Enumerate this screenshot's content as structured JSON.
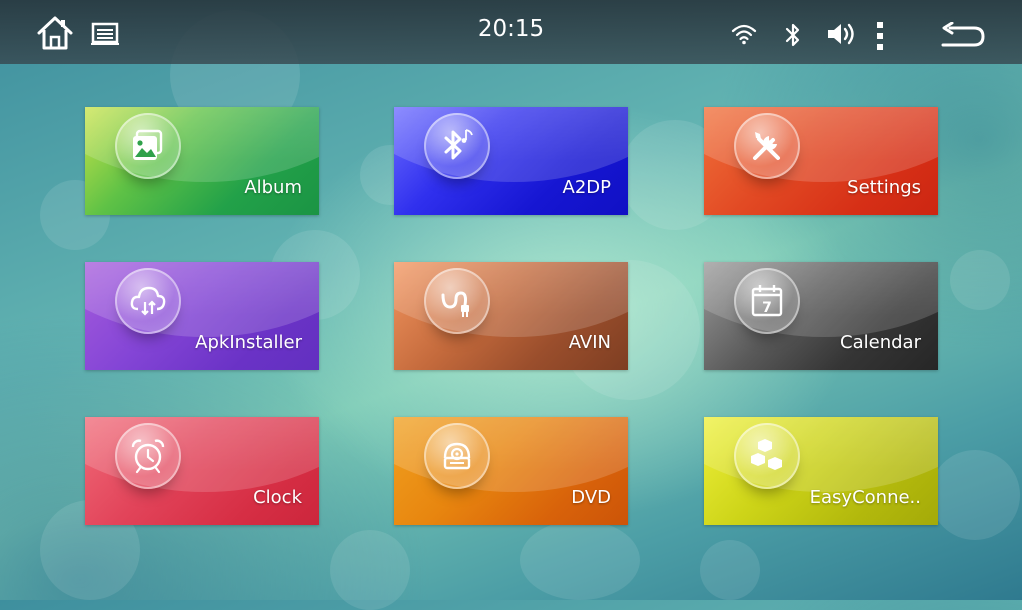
{
  "status_bar": {
    "time": "20:15",
    "icons": [
      "home-icon",
      "screen-icon",
      "wifi-icon",
      "bluetooth-icon",
      "volume-icon",
      "more-vert-icon",
      "back-icon"
    ]
  },
  "apps": [
    {
      "label": "Album",
      "icon": "album-icon",
      "color": "#2fb04a"
    },
    {
      "label": "A2DP",
      "icon": "bluetooth-music-icon",
      "color": "#1a1ad6"
    },
    {
      "label": "Settings",
      "icon": "settings-tools-icon",
      "color": "#e0321c"
    },
    {
      "label": "ApkInstaller",
      "icon": "cloud-install-icon",
      "color": "#7f3fd0"
    },
    {
      "label": "AVIN",
      "icon": "plug-cable-icon",
      "color": "#9a4e2c"
    },
    {
      "label": "Calendar",
      "icon": "calendar-icon",
      "color": "#3a3a3a"
    },
    {
      "label": "Clock",
      "icon": "alarm-clock-icon",
      "color": "#dd3048"
    },
    {
      "label": "DVD",
      "icon": "dvd-icon",
      "color": "#e57d12"
    },
    {
      "label": "EasyConne..",
      "icon": "cubes-icon",
      "color": "#b8be0c"
    }
  ],
  "calendar_day": "7"
}
